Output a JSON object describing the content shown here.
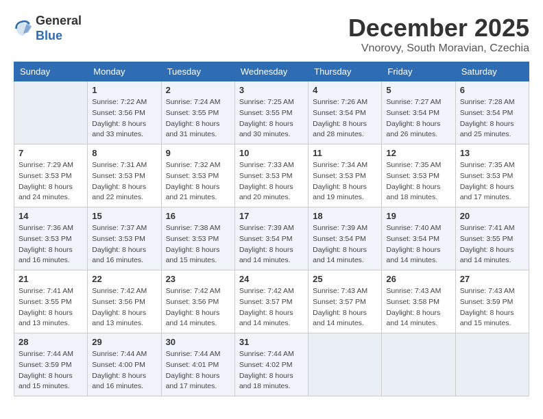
{
  "logo": {
    "general": "General",
    "blue": "Blue"
  },
  "title": "December 2025",
  "location": "Vnorovy, South Moravian, Czechia",
  "days_of_week": [
    "Sunday",
    "Monday",
    "Tuesday",
    "Wednesday",
    "Thursday",
    "Friday",
    "Saturday"
  ],
  "weeks": [
    [
      {
        "day": "",
        "info": ""
      },
      {
        "day": "1",
        "info": "Sunrise: 7:22 AM\nSunset: 3:56 PM\nDaylight: 8 hours\nand 33 minutes."
      },
      {
        "day": "2",
        "info": "Sunrise: 7:24 AM\nSunset: 3:55 PM\nDaylight: 8 hours\nand 31 minutes."
      },
      {
        "day": "3",
        "info": "Sunrise: 7:25 AM\nSunset: 3:55 PM\nDaylight: 8 hours\nand 30 minutes."
      },
      {
        "day": "4",
        "info": "Sunrise: 7:26 AM\nSunset: 3:54 PM\nDaylight: 8 hours\nand 28 minutes."
      },
      {
        "day": "5",
        "info": "Sunrise: 7:27 AM\nSunset: 3:54 PM\nDaylight: 8 hours\nand 26 minutes."
      },
      {
        "day": "6",
        "info": "Sunrise: 7:28 AM\nSunset: 3:54 PM\nDaylight: 8 hours\nand 25 minutes."
      }
    ],
    [
      {
        "day": "7",
        "info": "Sunrise: 7:29 AM\nSunset: 3:53 PM\nDaylight: 8 hours\nand 24 minutes."
      },
      {
        "day": "8",
        "info": "Sunrise: 7:31 AM\nSunset: 3:53 PM\nDaylight: 8 hours\nand 22 minutes."
      },
      {
        "day": "9",
        "info": "Sunrise: 7:32 AM\nSunset: 3:53 PM\nDaylight: 8 hours\nand 21 minutes."
      },
      {
        "day": "10",
        "info": "Sunrise: 7:33 AM\nSunset: 3:53 PM\nDaylight: 8 hours\nand 20 minutes."
      },
      {
        "day": "11",
        "info": "Sunrise: 7:34 AM\nSunset: 3:53 PM\nDaylight: 8 hours\nand 19 minutes."
      },
      {
        "day": "12",
        "info": "Sunrise: 7:35 AM\nSunset: 3:53 PM\nDaylight: 8 hours\nand 18 minutes."
      },
      {
        "day": "13",
        "info": "Sunrise: 7:35 AM\nSunset: 3:53 PM\nDaylight: 8 hours\nand 17 minutes."
      }
    ],
    [
      {
        "day": "14",
        "info": "Sunrise: 7:36 AM\nSunset: 3:53 PM\nDaylight: 8 hours\nand 16 minutes."
      },
      {
        "day": "15",
        "info": "Sunrise: 7:37 AM\nSunset: 3:53 PM\nDaylight: 8 hours\nand 16 minutes."
      },
      {
        "day": "16",
        "info": "Sunrise: 7:38 AM\nSunset: 3:53 PM\nDaylight: 8 hours\nand 15 minutes."
      },
      {
        "day": "17",
        "info": "Sunrise: 7:39 AM\nSunset: 3:54 PM\nDaylight: 8 hours\nand 14 minutes."
      },
      {
        "day": "18",
        "info": "Sunrise: 7:39 AM\nSunset: 3:54 PM\nDaylight: 8 hours\nand 14 minutes."
      },
      {
        "day": "19",
        "info": "Sunrise: 7:40 AM\nSunset: 3:54 PM\nDaylight: 8 hours\nand 14 minutes."
      },
      {
        "day": "20",
        "info": "Sunrise: 7:41 AM\nSunset: 3:55 PM\nDaylight: 8 hours\nand 14 minutes."
      }
    ],
    [
      {
        "day": "21",
        "info": "Sunrise: 7:41 AM\nSunset: 3:55 PM\nDaylight: 8 hours\nand 13 minutes."
      },
      {
        "day": "22",
        "info": "Sunrise: 7:42 AM\nSunset: 3:56 PM\nDaylight: 8 hours\nand 13 minutes."
      },
      {
        "day": "23",
        "info": "Sunrise: 7:42 AM\nSunset: 3:56 PM\nDaylight: 8 hours\nand 14 minutes."
      },
      {
        "day": "24",
        "info": "Sunrise: 7:42 AM\nSunset: 3:57 PM\nDaylight: 8 hours\nand 14 minutes."
      },
      {
        "day": "25",
        "info": "Sunrise: 7:43 AM\nSunset: 3:57 PM\nDaylight: 8 hours\nand 14 minutes."
      },
      {
        "day": "26",
        "info": "Sunrise: 7:43 AM\nSunset: 3:58 PM\nDaylight: 8 hours\nand 14 minutes."
      },
      {
        "day": "27",
        "info": "Sunrise: 7:43 AM\nSunset: 3:59 PM\nDaylight: 8 hours\nand 15 minutes."
      }
    ],
    [
      {
        "day": "28",
        "info": "Sunrise: 7:44 AM\nSunset: 3:59 PM\nDaylight: 8 hours\nand 15 minutes."
      },
      {
        "day": "29",
        "info": "Sunrise: 7:44 AM\nSunset: 4:00 PM\nDaylight: 8 hours\nand 16 minutes."
      },
      {
        "day": "30",
        "info": "Sunrise: 7:44 AM\nSunset: 4:01 PM\nDaylight: 8 hours\nand 17 minutes."
      },
      {
        "day": "31",
        "info": "Sunrise: 7:44 AM\nSunset: 4:02 PM\nDaylight: 8 hours\nand 18 minutes."
      },
      {
        "day": "",
        "info": ""
      },
      {
        "day": "",
        "info": ""
      },
      {
        "day": "",
        "info": ""
      }
    ]
  ]
}
